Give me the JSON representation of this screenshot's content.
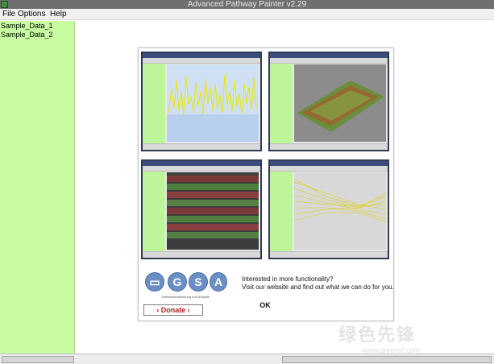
{
  "window": {
    "title": "Advanced Pathway Painter v2.29"
  },
  "menu": {
    "items": [
      "File",
      "Options",
      "Help"
    ]
  },
  "sidebar": {
    "items": [
      "Sample_Data_1",
      "Sample_Data_2"
    ]
  },
  "dialog": {
    "logo_letters": [
      "G",
      "S",
      "A"
    ],
    "logo_subtitle": "Softwareentwicklung und Analytik",
    "donate_label": "Donate",
    "message_line1": "Interested in more functionality?",
    "message_line2": "Visit our website and find out what we can do for you.",
    "ok_label": "OK"
  },
  "watermark": {
    "text": "绿色先锋",
    "sub": "www.greenxf.com"
  },
  "colors": {
    "sidebar_bg": "#c9fca0",
    "titlebar_bg": "#6f6f6f",
    "logo_blue": "#6b8fc4",
    "donate_red": "#b02020"
  }
}
